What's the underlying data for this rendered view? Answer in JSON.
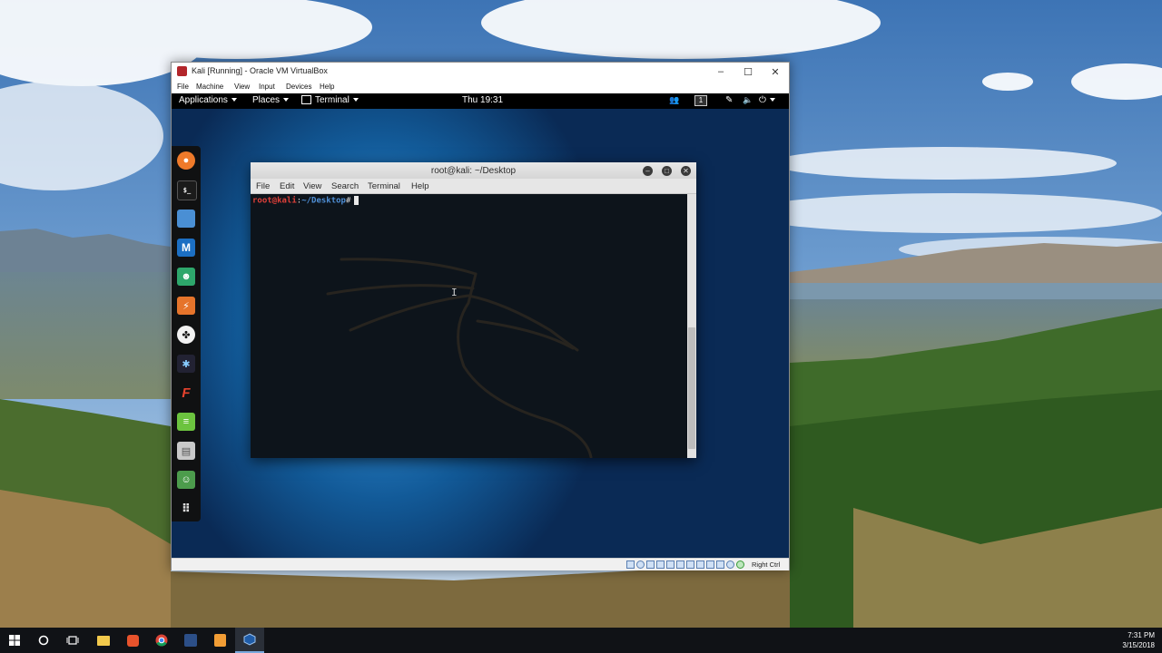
{
  "vbox": {
    "title": "Kali [Running] - Oracle VM VirtualBox",
    "minimize": "–",
    "maximize": "☐",
    "close": "✕",
    "menu": [
      "File",
      "Machine",
      "View",
      "Input",
      "Devices",
      "Help"
    ],
    "host_key": "Right Ctrl"
  },
  "guest": {
    "topbar": {
      "applications": "Applications",
      "places": "Places",
      "terminal": "Terminal",
      "clock": "Thu 19:31",
      "workspace": "1"
    },
    "dock_apps": [
      "firefox-esr",
      "terminal",
      "files",
      "metasploit",
      "armitage",
      "burp-suite",
      "maltego",
      "beef",
      "faraday",
      "leafpad",
      "cutycapt",
      "kali-avatar",
      "show-applications"
    ]
  },
  "terminal": {
    "title": "root@kali: ~/Desktop",
    "menu": [
      "File",
      "Edit",
      "View",
      "Search",
      "Terminal",
      "Help"
    ],
    "prompt_user": "root@kali",
    "prompt_sep": ":",
    "prompt_path": "~/Desktop",
    "prompt_char": "#"
  },
  "taskbar": {
    "apps": [
      "start",
      "cortana",
      "task-view",
      "file-explorer",
      "brave",
      "chrome",
      "app-blue",
      "sublime-text",
      "virtualbox"
    ],
    "time": "7:31 PM",
    "date": "3/15/2018"
  }
}
